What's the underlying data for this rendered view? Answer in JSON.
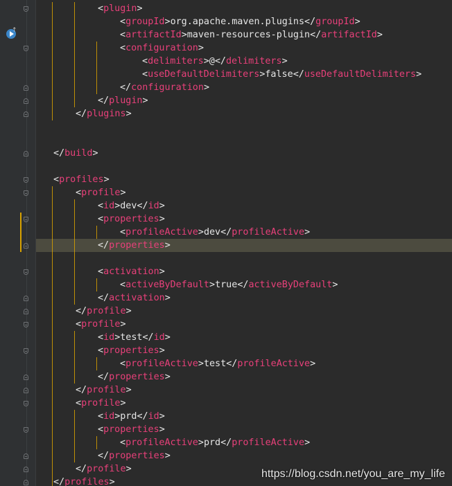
{
  "editor": {
    "lines": [
      {
        "indent": 2,
        "name": "plugin",
        "kind": "open"
      },
      {
        "indent": 3,
        "name": "groupId",
        "kind": "full",
        "text": "org.apache.maven.plugins"
      },
      {
        "indent": 3,
        "name": "artifactId",
        "kind": "full",
        "text": "maven-resources-plugin"
      },
      {
        "indent": 3,
        "name": "configuration",
        "kind": "open"
      },
      {
        "indent": 4,
        "name": "delimiters",
        "kind": "full",
        "text": "@"
      },
      {
        "indent": 4,
        "name": "useDefaultDelimiters",
        "kind": "full",
        "text": "false"
      },
      {
        "indent": 3,
        "name": "configuration",
        "kind": "close"
      },
      {
        "indent": 2,
        "name": "plugin",
        "kind": "close"
      },
      {
        "indent": 1,
        "name": "plugins",
        "kind": "close"
      },
      {
        "kind": "blank"
      },
      {
        "kind": "blank"
      },
      {
        "indent": 0,
        "name": "build",
        "kind": "close"
      },
      {
        "kind": "blank"
      },
      {
        "indent": 0,
        "name": "profiles",
        "kind": "open"
      },
      {
        "indent": 1,
        "name": "profile",
        "kind": "open"
      },
      {
        "indent": 2,
        "name": "id",
        "kind": "full",
        "text": "dev"
      },
      {
        "indent": 2,
        "name": "properties",
        "kind": "open"
      },
      {
        "indent": 3,
        "name": "profileActive",
        "kind": "full",
        "text": "dev"
      },
      {
        "indent": 2,
        "name": "properties",
        "kind": "close",
        "current": true
      },
      {
        "kind": "blank"
      },
      {
        "indent": 2,
        "name": "activation",
        "kind": "open"
      },
      {
        "indent": 3,
        "name": "activeByDefault",
        "kind": "full",
        "text": "true"
      },
      {
        "indent": 2,
        "name": "activation",
        "kind": "close"
      },
      {
        "indent": 1,
        "name": "profile",
        "kind": "close"
      },
      {
        "indent": 1,
        "name": "profile",
        "kind": "open"
      },
      {
        "indent": 2,
        "name": "id",
        "kind": "full",
        "text": "test"
      },
      {
        "indent": 2,
        "name": "properties",
        "kind": "open"
      },
      {
        "indent": 3,
        "name": "profileActive",
        "kind": "full",
        "text": "test"
      },
      {
        "indent": 2,
        "name": "properties",
        "kind": "close"
      },
      {
        "indent": 1,
        "name": "profile",
        "kind": "close"
      },
      {
        "indent": 1,
        "name": "profile",
        "kind": "open"
      },
      {
        "indent": 2,
        "name": "id",
        "kind": "full",
        "text": "prd"
      },
      {
        "indent": 2,
        "name": "properties",
        "kind": "open"
      },
      {
        "indent": 3,
        "name": "profileActive",
        "kind": "full",
        "text": "prd"
      },
      {
        "indent": 2,
        "name": "properties",
        "kind": "close"
      },
      {
        "indent": 1,
        "name": "profile",
        "kind": "close"
      },
      {
        "indent": 0,
        "name": "profiles",
        "kind": "close"
      }
    ],
    "gutter_numbers": [
      "",
      "",
      "",
      "",
      "",
      "",
      "",
      "",
      "",
      "",
      "",
      "",
      "",
      "",
      "",
      "",
      "",
      "",
      "",
      "",
      "",
      "",
      "",
      "",
      "",
      "",
      "",
      "",
      "",
      "",
      "",
      "",
      "",
      "",
      "",
      "",
      ""
    ],
    "run_icon": "maven-run-gutter-icon",
    "colors": {
      "background": "#2b2b2b",
      "tag_name": "#e8407a",
      "bracket": "#e8bf6a",
      "text": "#e6e6e6",
      "current_line": "#4c4b3f",
      "indent_guide": "#d9a200"
    }
  },
  "watermark": "https://blog.csdn.net/you_are_my_life"
}
